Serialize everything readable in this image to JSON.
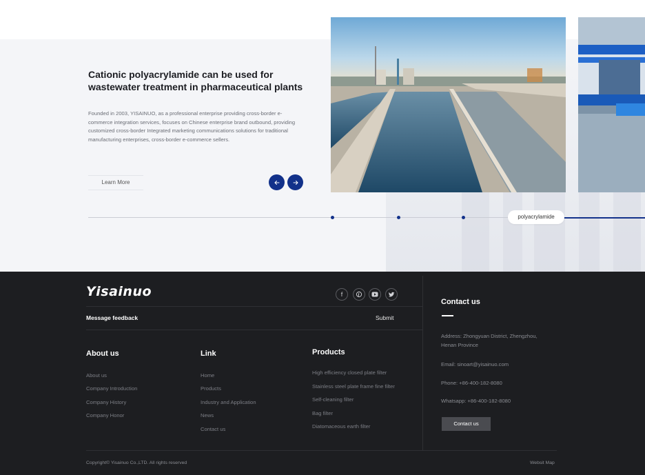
{
  "hero": {
    "title": "Cationic polyacrylamide can be used for wastewater treatment in pharmaceutical plants",
    "description": "Founded in 2003, YISAINUO, as a professional enterprise providing cross-border e-commerce integration services, focuses on Chinese enterprise brand outbound, providing customized cross-border Integrated marketing communications solutions for traditional manufacturing enterprises, cross-border e-commerce sellers.",
    "learn_more": "Learn More",
    "prev_icon": "arrow-left-icon",
    "next_icon": "arrow-right-icon",
    "timeline_label": "polyacrylamide",
    "accent_color": "#12318a"
  },
  "footer": {
    "logo": "Yisainuo",
    "social_icons": [
      "facebook-icon",
      "pinterest-icon",
      "youtube-icon",
      "twitter-icon"
    ],
    "message_label": "Message feedback",
    "submit_label": "Submit",
    "about": {
      "title": "About us",
      "links": [
        "About us",
        "Company Introduction",
        "Company History",
        "Company Honor"
      ]
    },
    "link": {
      "title": "Link",
      "links": [
        "Home",
        "Products",
        "Industry and Application",
        "News",
        "Contact us"
      ]
    },
    "products": {
      "title": "Products",
      "links": [
        "High efficiency closed plate filter",
        "Stainless steel plate frame fine filter",
        "Self-cleaning filter",
        "Bag filter",
        "Diatomaceous earth filter"
      ]
    },
    "contact": {
      "title": "Contact us",
      "address": "Address: Zhongyuan District, Zhengzhou, Henan Province",
      "email": "Email: sinoart@yisainuo.com",
      "phone": "Phone: +86-400-182-8080",
      "whatsapp": "Whatsapp: +86-400-182-8080",
      "button": "Contact us"
    },
    "copyright": "Copyright© Yisainuo Co.,LTD. All rights reserved",
    "sitemap": "Websit Map",
    "background_color": "#1d1e21"
  }
}
